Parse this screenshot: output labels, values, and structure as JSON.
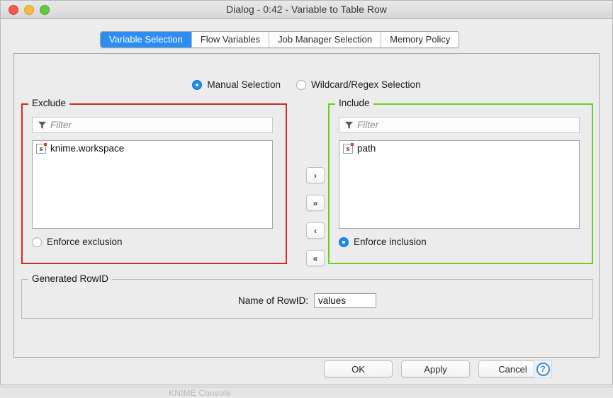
{
  "window": {
    "title": "Dialog - 0:42 - Variable to Table Row",
    "traffic_lights": [
      "close",
      "minimize",
      "zoom"
    ]
  },
  "tabs": [
    {
      "label": "Variable Selection",
      "active": true
    },
    {
      "label": "Flow Variables",
      "active": false
    },
    {
      "label": "Job Manager Selection",
      "active": false
    },
    {
      "label": "Memory Policy",
      "active": false
    }
  ],
  "selection_mode": {
    "manual": {
      "label": "Manual Selection",
      "selected": true
    },
    "wildcard": {
      "label": "Wildcard/Regex Selection",
      "selected": false
    }
  },
  "exclude": {
    "title": "Exclude",
    "border_color": "#cc2b26",
    "filter_placeholder": "Filter",
    "items": [
      {
        "icon": "s",
        "label": "knime.workspace"
      }
    ],
    "enforce": {
      "label": "Enforce exclusion",
      "selected": false
    }
  },
  "include": {
    "title": "Include",
    "border_color": "#6fcf1e",
    "filter_placeholder": "Filter",
    "items": [
      {
        "icon": "s",
        "label": "path"
      }
    ],
    "enforce": {
      "label": "Enforce inclusion",
      "selected": true
    }
  },
  "transfer_buttons": [
    {
      "name": "move-right",
      "glyph": "›"
    },
    {
      "name": "move-all-right",
      "glyph": "»"
    },
    {
      "name": "move-left",
      "glyph": "‹"
    },
    {
      "name": "move-all-left",
      "glyph": "«"
    }
  ],
  "generated_rowid": {
    "title": "Generated RowID",
    "field_label": "Name of RowID:",
    "field_value": "values"
  },
  "dialog_buttons": {
    "ok": "OK",
    "apply": "Apply",
    "cancel": "Cancel",
    "help": "?"
  },
  "background": {
    "console_label": "KNIME Console"
  }
}
